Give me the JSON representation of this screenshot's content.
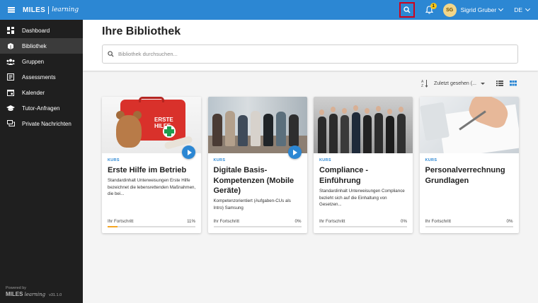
{
  "topbar": {
    "brand": "MILES",
    "brand_sub": "learning",
    "notification_count": "1",
    "user_initials": "SG",
    "user_name": "Sigrid Gruber",
    "language": "DE",
    "accent_color": "#2c87d3"
  },
  "sidebar": {
    "items": [
      {
        "label": "Dashboard",
        "icon": "dashboard-icon"
      },
      {
        "label": "Bibliothek",
        "icon": "library-icon",
        "active": true
      },
      {
        "label": "Gruppen",
        "icon": "groups-icon"
      },
      {
        "label": "Assessments",
        "icon": "assessment-icon"
      },
      {
        "label": "Kalender",
        "icon": "calendar-icon"
      },
      {
        "label": "Tutor-Anfragen",
        "icon": "graduation-cap-icon"
      },
      {
        "label": "Private Nachrichten",
        "icon": "chat-icon"
      }
    ],
    "footer": {
      "powered": "Powered by",
      "brand": "MILES",
      "brand_sub": "learning",
      "version": "v31.1.0"
    }
  },
  "main": {
    "title": "Ihre Bibliothek",
    "search_placeholder": "Bibliothek durchsuchen...",
    "sort_label": "Zuletzt gesehen (..."
  },
  "cards": [
    {
      "kind": "KURS",
      "title": "Erste Hilfe im Betrieb",
      "description": "Standardinhalt Unterweisungen Erste Hilfe bezeichnet die lebensrettenden Maßnahmen, die bei...",
      "progress_label": "Ihr Fortschritt",
      "progress": "11%",
      "progress_value": 11,
      "image_text": "ERSTE HILFE",
      "has_play": true
    },
    {
      "kind": "KURS",
      "title": "Digitale Basis-Kompetenzen (Mobile Geräte)",
      "description": "Kompetenzorientiert (Aufgaben-CUs als Intro) Samsung",
      "progress_label": "Ihr Fortschritt",
      "progress": "0%",
      "progress_value": 0,
      "has_play": true
    },
    {
      "kind": "KURS",
      "title": "Compliance - Einführung",
      "description": "Standardinhalt Unterweisungen Compliance bezieht sich auf die Einhaltung von Gesetzen...",
      "progress_label": "Ihr Fortschritt",
      "progress": "0%",
      "progress_value": 0,
      "has_play": false
    },
    {
      "kind": "KURS",
      "title": "Personalverrechnung Grundlagen",
      "description": "",
      "progress_label": "Ihr Fortschritt",
      "progress": "0%",
      "progress_value": 0,
      "has_play": false
    }
  ]
}
